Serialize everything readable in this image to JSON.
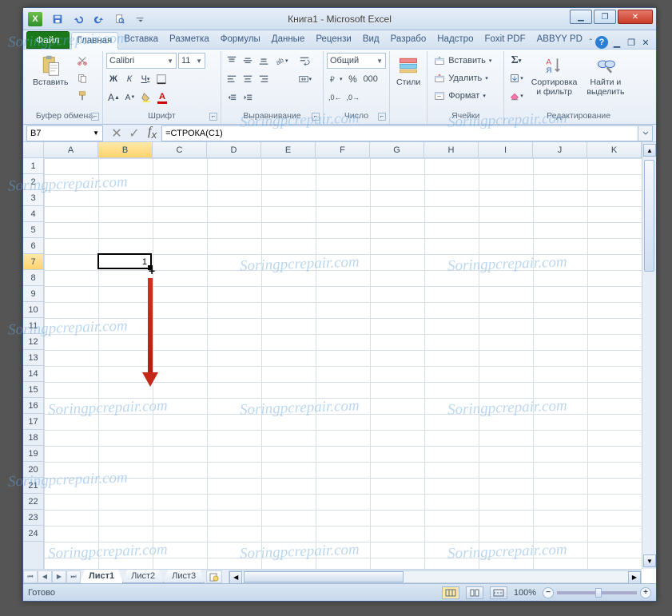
{
  "watermark": "Soringpcrepair.com",
  "titlebar": {
    "title": "Книга1 - Microsoft Excel"
  },
  "window_controls": {
    "minimize": "▁",
    "maximize": "❐",
    "close": "✕"
  },
  "inner_window_controls": {
    "minimize": "▁",
    "restore": "❐",
    "close": "✕"
  },
  "ribbon_tabs": {
    "file": "Файл",
    "items": [
      "Главная",
      "Вставка",
      "Разметка",
      "Формулы",
      "Данные",
      "Рецензи",
      "Вид",
      "Разрабо",
      "Надстро",
      "Foxit PDF",
      "ABBYY PD"
    ],
    "active_index": 0
  },
  "ribbon": {
    "clipboard": {
      "paste": "Вставить",
      "label": "Буфер обмена"
    },
    "font": {
      "name": "Calibri",
      "size": "11",
      "label": "Шрифт"
    },
    "alignment": {
      "label": "Выравнивание"
    },
    "number": {
      "format": "Общий",
      "label": "Число"
    },
    "styles": {
      "button": "Стили"
    },
    "cells": {
      "insert": "Вставить",
      "delete": "Удалить",
      "format": "Формат",
      "label": "Ячейки"
    },
    "editing": {
      "sort": "Сортировка\nи фильтр",
      "find": "Найти и\nвыделить",
      "label": "Редактирование"
    }
  },
  "namebox": "B7",
  "formula": "=СТРОКА(C1)",
  "columns": [
    "A",
    "B",
    "C",
    "D",
    "E",
    "F",
    "G",
    "H",
    "I",
    "J",
    "K"
  ],
  "rows": [
    1,
    2,
    3,
    4,
    5,
    6,
    7,
    8,
    9,
    10,
    11,
    12,
    13,
    14,
    15,
    16,
    17,
    18,
    19,
    20,
    21,
    22,
    23,
    24
  ],
  "selected": {
    "col": "B",
    "row": 7,
    "value": "1"
  },
  "sheets": {
    "items": [
      "Лист1",
      "Лист2",
      "Лист3"
    ],
    "active_index": 0
  },
  "status": {
    "ready": "Готово",
    "zoom": "100%"
  }
}
